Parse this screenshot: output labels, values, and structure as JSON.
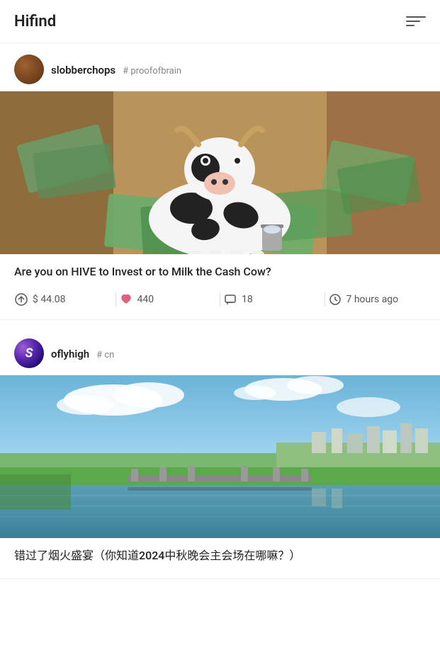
{
  "app": {
    "title": "Hifind"
  },
  "filter_icon_label": "filter",
  "posts": [
    {
      "id": "post-1",
      "author": "slobberchops",
      "tag_prefix": "#",
      "tag": "proofofbrain",
      "title": "Are you on HIVE to Invest or to Milk the Cash Cow?",
      "stats": {
        "value": "$ 44.08",
        "likes": "440",
        "comments": "18",
        "time": "7 hours ago"
      },
      "image_alt": "Cow standing on money bills with a milk pail"
    },
    {
      "id": "post-2",
      "author": "oflyhigh",
      "tag_prefix": "#",
      "tag": "cn",
      "title": "错过了烟火盛宴（你知道2024中秋晚会主会场在哪嘛？）",
      "image_alt": "River landscape with blue sky and clouds"
    }
  ]
}
